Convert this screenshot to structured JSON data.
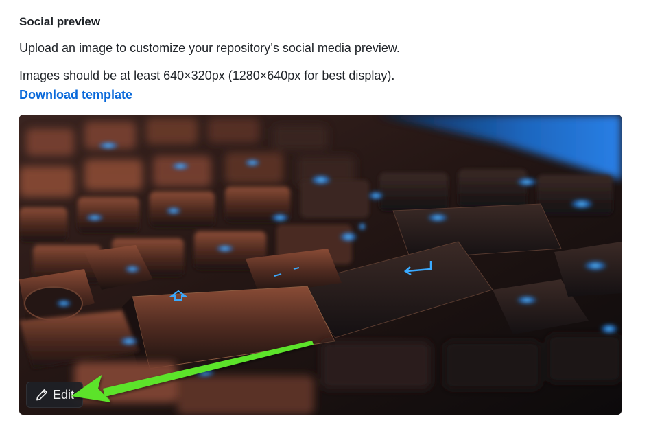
{
  "social_preview": {
    "title": "Social preview",
    "description": "Upload an image to customize your repository’s social media preview.",
    "size_hint": "Images should be at least 640×320px (1280×640px for best display).",
    "download_link": "Download template",
    "image": {
      "subject": "backlit computer keyboard"
    },
    "edit_button": {
      "label": "Edit",
      "icon": "pencil-icon"
    }
  },
  "annotation": {
    "type": "arrow",
    "color": "#5be32a",
    "points_to": "edit-button"
  },
  "colors": {
    "link": "#0969da",
    "text": "#1f2328",
    "key_backlight": "#2fa4ff",
    "key_surface": "#6b3a2a"
  }
}
